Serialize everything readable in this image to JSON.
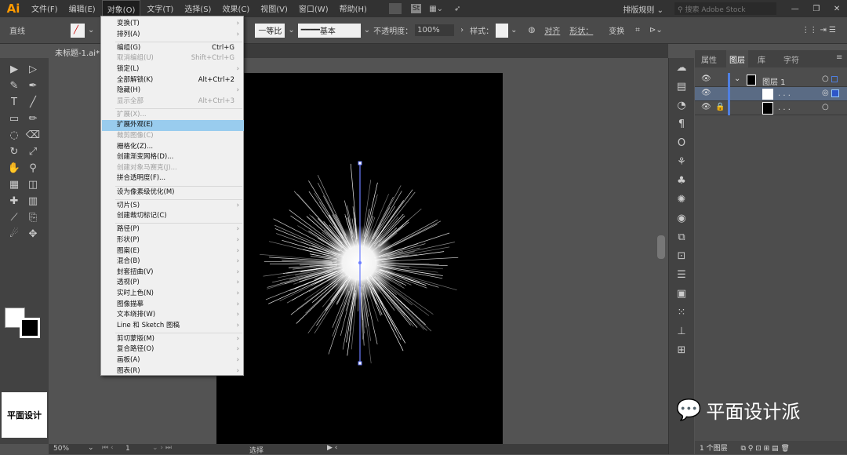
{
  "app": {
    "logo": "Ai",
    "accent": "#ff9a00"
  },
  "menubar": {
    "items": [
      "文件(F)",
      "编辑(E)",
      "对象(O)",
      "文字(T)",
      "选择(S)",
      "效果(C)",
      "视图(V)",
      "窗口(W)",
      "帮助(H)"
    ],
    "active": "对象(O)",
    "workspace": "排版规则",
    "search_placeholder": "搜索 Adobe Stock"
  },
  "controlbar": {
    "selection": "直线",
    "stroke_profile": "等比",
    "brush": "基本",
    "opacity_label": "不透明度：",
    "opacity": "100%",
    "style_label": "样式：",
    "align": "对齐",
    "shape": "形状：",
    "transform": "变换"
  },
  "document": {
    "tab": "未标题-1.ai*"
  },
  "menu": {
    "items": [
      {
        "label": "变换(T)",
        "sub": true
      },
      {
        "label": "排列(A)",
        "sub": true,
        "sep_after": true
      },
      {
        "label": "编组(G)",
        "shortcut": "Ctrl+G"
      },
      {
        "label": "取消编组(U)",
        "shortcut": "Shift+Ctrl+G",
        "disabled": true
      },
      {
        "label": "锁定(L)",
        "sub": true
      },
      {
        "label": "全部解锁(K)",
        "shortcut": "Alt+Ctrl+2"
      },
      {
        "label": "隐藏(H)",
        "sub": true
      },
      {
        "label": "显示全部",
        "shortcut": "Alt+Ctrl+3",
        "disabled": true,
        "sep_after": true
      },
      {
        "label": "扩展(X)...",
        "disabled": true
      },
      {
        "label": "扩展外观(E)",
        "highlighted": true
      },
      {
        "label": "裁剪图像(C)",
        "disabled": true
      },
      {
        "label": "栅格化(Z)..."
      },
      {
        "label": "创建渐变网格(D)..."
      },
      {
        "label": "创建对象马赛克(J)...",
        "disabled": true
      },
      {
        "label": "拼合透明度(F)...",
        "sep_after": true
      },
      {
        "label": "设为像素级优化(M)",
        "sep_after": true
      },
      {
        "label": "切片(S)",
        "sub": true
      },
      {
        "label": "创建裁切标记(C)",
        "sep_after": true
      },
      {
        "label": "路径(P)",
        "sub": true
      },
      {
        "label": "形状(P)",
        "sub": true
      },
      {
        "label": "图案(E)",
        "sub": true
      },
      {
        "label": "混合(B)",
        "sub": true
      },
      {
        "label": "封套扭曲(V)",
        "sub": true
      },
      {
        "label": "透视(P)",
        "sub": true
      },
      {
        "label": "实时上色(N)",
        "sub": true
      },
      {
        "label": "图像描摹",
        "sub": true
      },
      {
        "label": "文本绕排(W)",
        "sub": true
      },
      {
        "label": "Line 和 Sketch 图稿",
        "sub": true,
        "sep_after": true
      },
      {
        "label": "剪切蒙版(M)",
        "sub": true
      },
      {
        "label": "复合路径(O)",
        "sub": true
      },
      {
        "label": "画板(A)",
        "sub": true
      },
      {
        "label": "图表(R)",
        "sub": true
      }
    ]
  },
  "layers_panel": {
    "tabs": [
      "属性",
      "图层",
      "库",
      "字符"
    ],
    "active_tab": "图层",
    "layers": [
      {
        "name": "图层 1"
      },
      {
        "name": ". . ."
      },
      {
        "name": ". . ."
      }
    ],
    "footer": "1 个图层"
  },
  "status": {
    "zoom": "50%",
    "page": "1",
    "tool": "选择"
  },
  "watermark": {
    "text": "平面设计派",
    "thumb_text": "平面设计"
  }
}
